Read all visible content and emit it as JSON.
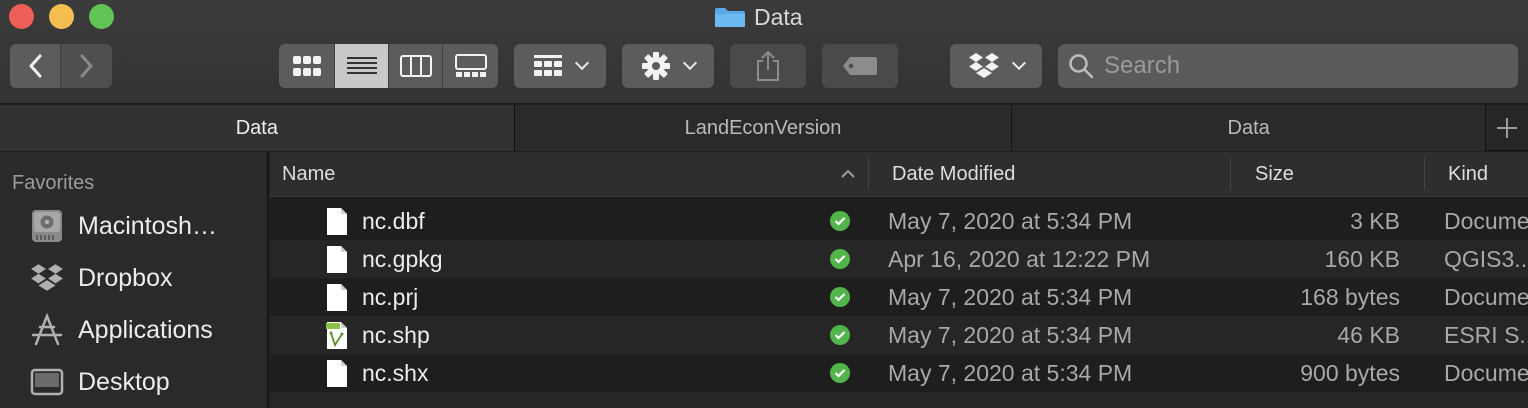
{
  "window": {
    "title": "Data"
  },
  "toolbar": {
    "search_placeholder": "Search"
  },
  "tabs": [
    {
      "label": "Data",
      "active": true
    },
    {
      "label": "LandEconVersion",
      "active": false
    },
    {
      "label": "Data",
      "active": false
    }
  ],
  "sidebar": {
    "heading": "Favorites",
    "items": [
      {
        "label": "Macintosh…",
        "icon": "hard-drive-icon"
      },
      {
        "label": "Dropbox",
        "icon": "dropbox-icon"
      },
      {
        "label": "Applications",
        "icon": "applications-icon"
      },
      {
        "label": "Desktop",
        "icon": "desktop-icon"
      }
    ]
  },
  "columns": {
    "name": "Name",
    "date": "Date Modified",
    "size": "Size",
    "kind": "Kind"
  },
  "files": [
    {
      "name": "nc.dbf",
      "date": "May 7, 2020 at 5:34 PM",
      "size": "3 KB",
      "kind": "Docume",
      "icon": "document-icon"
    },
    {
      "name": "nc.gpkg",
      "date": "Apr 16, 2020 at 12:22 PM",
      "size": "160 KB",
      "kind": "QGIS3...",
      "icon": "document-icon"
    },
    {
      "name": "nc.prj",
      "date": "May 7, 2020 at 5:34 PM",
      "size": "168 bytes",
      "kind": "Docume",
      "icon": "document-icon"
    },
    {
      "name": "nc.shp",
      "date": "May 7, 2020 at 5:34 PM",
      "size": "46 KB",
      "kind": "ESRI S...",
      "icon": "shp-file-icon"
    },
    {
      "name": "nc.shx",
      "date": "May 7, 2020 at 5:34 PM",
      "size": "900 bytes",
      "kind": "Docume",
      "icon": "document-icon"
    }
  ],
  "colors": {
    "accent_green": "#52b44a",
    "folder_blue": "#5aa9e6"
  }
}
